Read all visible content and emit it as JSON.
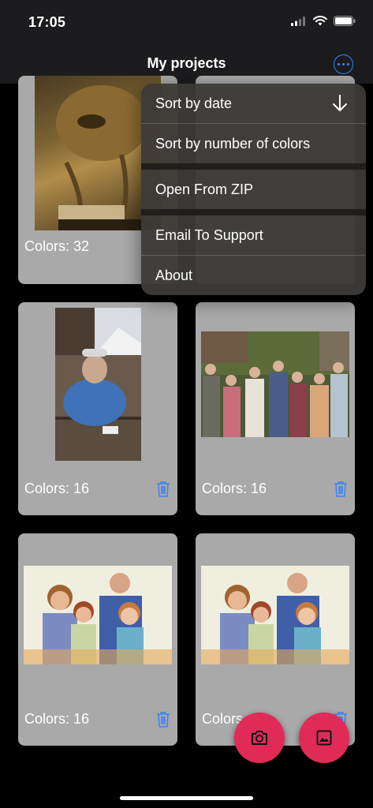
{
  "status": {
    "time": "17:05"
  },
  "nav": {
    "title": "My projects",
    "more_icon": "ellipsis-circle-icon"
  },
  "menu": {
    "items": [
      {
        "label": "Sort by date",
        "icon": "arrow-down-icon"
      },
      {
        "label": "Sort by number of colors"
      },
      {
        "label": "Open From ZIP"
      },
      {
        "label": "Email To Support"
      },
      {
        "label": "About"
      }
    ]
  },
  "projects": [
    {
      "colors_label": "Colors: 32",
      "image": "surreal-sculpture"
    },
    {
      "colors_label": "Colors: 16",
      "image": "ski-girl"
    },
    {
      "colors_label": "Colors: 16",
      "image": "group-outdoors"
    },
    {
      "colors_label": "Colors: 16",
      "image": "family-portrait"
    },
    {
      "colors_label": "Colors",
      "image": "family-portrait"
    }
  ],
  "actions": {
    "camera_icon": "camera-icon",
    "gallery_icon": "gallery-icon"
  },
  "colors": {
    "accent": "#3a82f7",
    "fab": "#e02b58",
    "card": "#a9a9a9"
  }
}
